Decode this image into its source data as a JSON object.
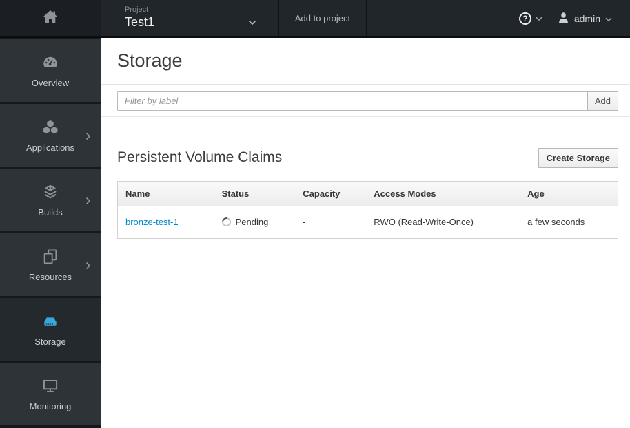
{
  "topbar": {
    "project_label": "Project",
    "project_name": "Test1",
    "add_to_project_label": "Add to project",
    "username": "admin",
    "icons": [
      "home-icon",
      "chevron-down-icon",
      "help-icon",
      "user-icon"
    ]
  },
  "sidebar": {
    "items": [
      {
        "label": "Overview",
        "icon": "dashboard-icon",
        "expandable": false,
        "active": false
      },
      {
        "label": "Applications",
        "icon": "cubes-icon",
        "expandable": true,
        "active": false
      },
      {
        "label": "Builds",
        "icon": "builds-icon",
        "expandable": true,
        "active": false
      },
      {
        "label": "Resources",
        "icon": "copy-icon",
        "expandable": true,
        "active": false
      },
      {
        "label": "Storage",
        "icon": "storage-drive-icon",
        "expandable": false,
        "active": true
      },
      {
        "label": "Monitoring",
        "icon": "monitor-icon",
        "expandable": false,
        "active": false
      }
    ]
  },
  "main": {
    "page_title": "Storage",
    "filter": {
      "placeholder": "Filter by label",
      "add_label": "Add"
    },
    "pvc": {
      "heading": "Persistent Volume Claims",
      "create_label": "Create Storage",
      "table": {
        "columns": [
          "Name",
          "Status",
          "Capacity",
          "Access Modes",
          "Age"
        ],
        "rows": [
          {
            "name": "bronze-test-1",
            "status": "Pending",
            "status_icon": "spinner-icon",
            "capacity": "-",
            "access_modes": "RWO (Read-Write-Once)",
            "age": "a few seconds"
          }
        ]
      }
    }
  },
  "colors": {
    "link": "#0088ce",
    "active_icon_blue": "#39a7dc",
    "topbar_bg": "#21262a",
    "sidebar_item_bg": "#2e3338",
    "sidebar_active_bg": "#24292e"
  }
}
